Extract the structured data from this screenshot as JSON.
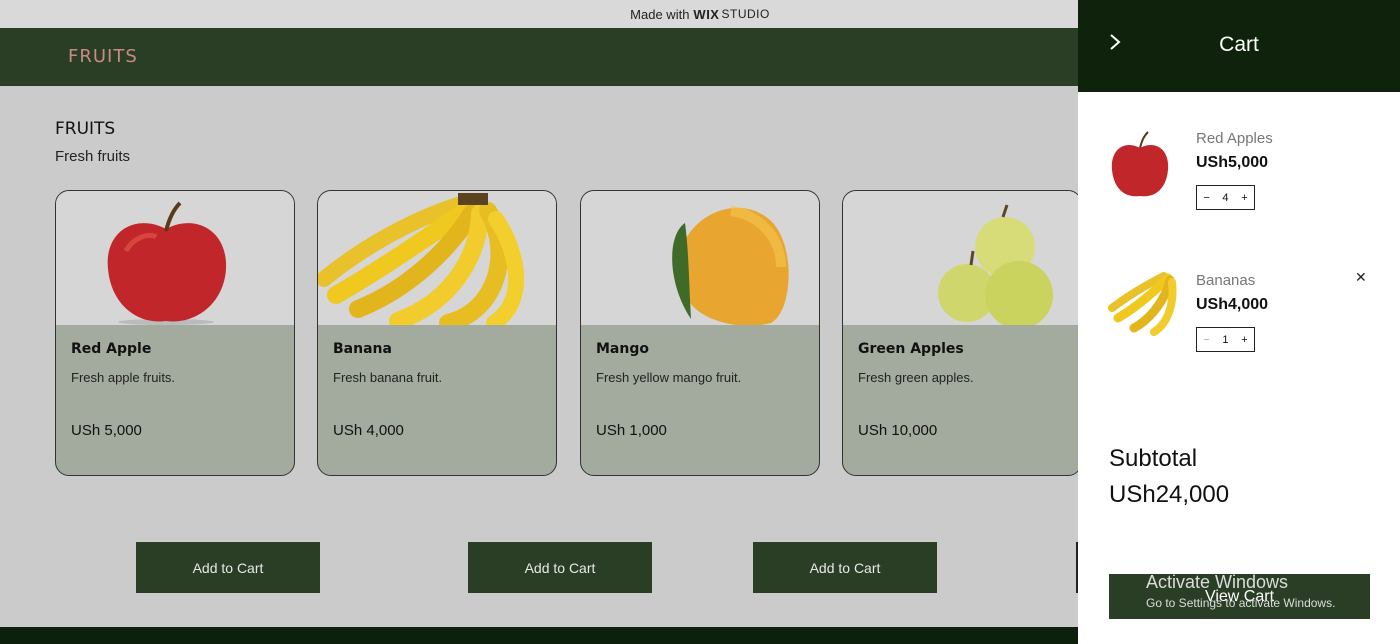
{
  "banner": {
    "made_with": "Made with",
    "brand": "WIX",
    "studio": "STUDIO"
  },
  "header": {
    "brand": "FRUITS"
  },
  "section": {
    "title": "FRUITS",
    "subtitle": "Fresh fruits"
  },
  "products": [
    {
      "name": "Red Apple",
      "desc": "Fresh apple fruits.",
      "price": "USh 5,000",
      "image": "red-apple"
    },
    {
      "name": "Banana",
      "desc": "Fresh banana fruit.",
      "price": "USh 4,000",
      "image": "banana"
    },
    {
      "name": "Mango",
      "desc": "Fresh yellow mango fruit.",
      "price": "USh 1,000",
      "image": "mango"
    },
    {
      "name": "Green Apples",
      "desc": "Fresh green apples.",
      "price": "USh 10,000",
      "image": "green-apples"
    }
  ],
  "add_to_cart_label": "Add to Cart",
  "cart": {
    "title": "Cart",
    "items": [
      {
        "name": "Red Apples",
        "price": "USh5,000",
        "qty": "4"
      },
      {
        "name": "Bananas",
        "price": "USh4,000",
        "qty": "1"
      }
    ],
    "subtotal_label": "Subtotal",
    "subtotal_value": "USh24,000",
    "view_cart_label": "View Cart"
  },
  "watermark": {
    "line1": "Activate Windows",
    "line2": "Go to Settings to activate Windows."
  },
  "colors": {
    "header": "#2a3e26",
    "cart_header": "#0f230c",
    "brand_text": "#c98a84",
    "card_body": "#a3aa9e"
  }
}
